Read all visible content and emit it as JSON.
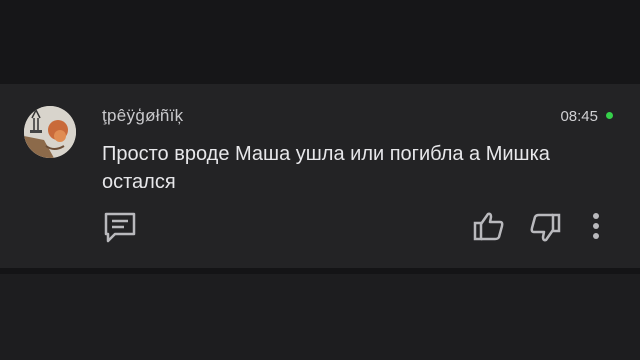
{
  "comment": {
    "author": "ţpêÿģøłñïķ",
    "time": "08:45",
    "message": "Просто вроде Маша ушла или погибла а Мишка остался"
  },
  "icons": {
    "avatar": "avatar-image",
    "reply": "comment-reply-icon",
    "like": "thumbs-up-icon",
    "dislike": "thumbs-down-icon",
    "more": "more-vertical-icon"
  },
  "colors": {
    "card_bg": "#232325",
    "text": "#e7e7ea",
    "online": "#35d04a"
  }
}
